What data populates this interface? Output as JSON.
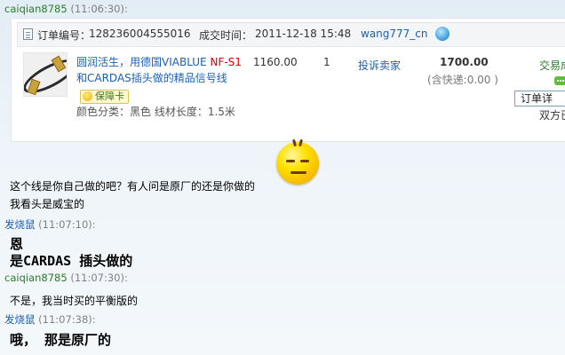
{
  "messages": [
    {
      "sender": "caiqian8785",
      "time": "(11:06:30):"
    },
    {
      "text1": "这个线是你自己做的吧？有人问是原厂的还是你做的",
      "text2": "我看头是威宝的"
    },
    {
      "sender": "发烧鼠",
      "time": "(11:07:10):",
      "line1": "恩",
      "line2": "是CARDAS 插头做的"
    },
    {
      "sender": "caiqian8785",
      "time": "(11:07:30):",
      "text": "不是，我当时买的平衡版的"
    },
    {
      "sender": "发烧鼠",
      "time": "(11:07:38):",
      "line1": "哦， 那是原厂的"
    }
  ],
  "order": {
    "number_label": "订单编号：",
    "number": "128236004555016",
    "deal_time_label": "成交时间：",
    "deal_time": "2011-12-18 15:48",
    "seller": "wang777_cn",
    "product": {
      "title_a": "圆润活生，用德国VIABLUE ",
      "title_red": "NF-S1",
      "title_b": "和CARDAS插头做的精品信号线",
      "guarantee_badge": "保障卡",
      "attributes": "颜色分类：黑色  线材长度：1.5米"
    },
    "price": "1160.00",
    "quantity": "1",
    "complaint_link": "投诉卖家",
    "total": "1700.00",
    "shipping": "(含快递:0.00 )",
    "status": "交易成",
    "detail_button": "订单详",
    "rating": "双方已"
  },
  "colors": {
    "sender_buyer": "#2d7a2d",
    "sender_seller": "#1b5fb4",
    "link": "#1b5fb4",
    "highlight": "#d40000"
  },
  "icons": {
    "smiley": "grin-smiley-icon",
    "seller": "wangwang-icon"
  }
}
